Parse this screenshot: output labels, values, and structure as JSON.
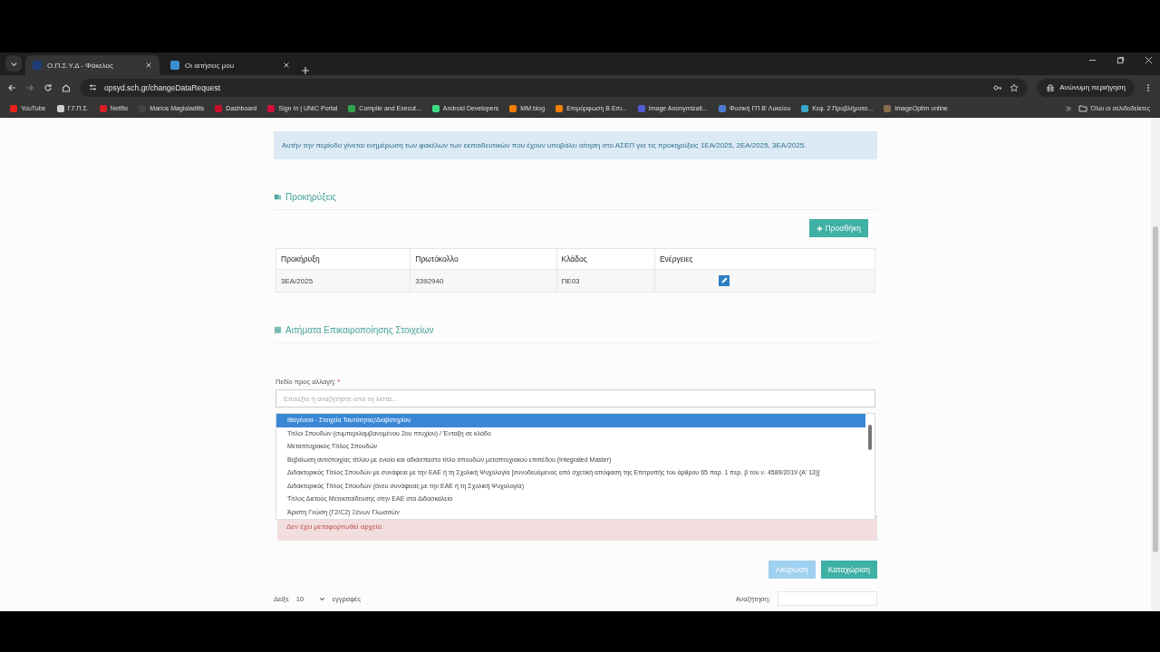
{
  "browser": {
    "tabs": [
      {
        "title": "Ο.Π.Σ.Υ.Δ - Φάκελος",
        "selected": true
      },
      {
        "title": "Οι αιτήσεις μου",
        "selected": false
      }
    ],
    "url": "opsyd.sch.gr/changeDataRequest",
    "profile_label": "Ανώνυμη περιήγηση",
    "bookmarks": [
      {
        "label": "YouTube",
        "color": "#e62117"
      },
      {
        "label": "Γ.Γ.Π.Σ.",
        "color": "#cfcfcf"
      },
      {
        "label": "Netflix",
        "color": "#d81f26"
      },
      {
        "label": "Marios Magioladitis",
        "color": "#444444"
      },
      {
        "label": "Dashboard",
        "color": "#c8102e"
      },
      {
        "label": "Sign In | UNIC Portal",
        "color": "#d0103a"
      },
      {
        "label": "Compile and Execut...",
        "color": "#2ea44f"
      },
      {
        "label": "Android Developers",
        "color": "#3ddc84"
      },
      {
        "label": "MM blog",
        "color": "#f57d00"
      },
      {
        "label": "Επιμόρφωση Β Επι...",
        "color": "#f57d00"
      },
      {
        "label": "Image Anonymizati...",
        "color": "#4f5bd5"
      },
      {
        "label": "Φυσική ΓΠ Β' Λυκείου",
        "color": "#4a7bd0"
      },
      {
        "label": "Κεφ. 2 Προβλήματα...",
        "color": "#3aa6c9"
      },
      {
        "label": "ImageOptim online",
        "color": "#8a6d4f"
      }
    ],
    "all_bookmarks": "Όλοι οι σελιδοδείκτες"
  },
  "page": {
    "notice": "Αυτήν την περίοδο γίνεται ενημέρωση των φακέλων των εκπαιδευτικών που έχουν υποβάλει αίτηση στο ΑΣΕΠ για τις προκηρύξεις 1ΕΑ/2025, 2ΕΑ/2025, 3ΕΑ/2025.",
    "announcements": {
      "title": "Προκηρύξεις",
      "add_button": "Προσθήκη",
      "columns": [
        "Προκήρυξη",
        "Πρωτόκολλο",
        "Κλάδος",
        "Ενέργειες"
      ],
      "rows": [
        [
          "3ΕΑ/2025",
          "3392940",
          "ΠΕ03"
        ]
      ]
    },
    "requests": {
      "title": "Αιτήματα Επικαιροποίησης Στοιχείων",
      "field_label": "Πεδίο προς αλλαγή:",
      "required_mark": "*",
      "placeholder": "Επιλέξτε ή αναζητήστε από τη λίστα...",
      "options": [
        {
          "label": "Ιθαγένεια - Στοιχεία Ταυτότητας/Διαβατηρίου",
          "selected": true
        },
        {
          "label": "Τίτλοι Σπουδών (συμπεριλαμβανομένου 2ου πτυχίου) / Ένταξη σε κλάδο",
          "selected": false
        },
        {
          "label": "Μεταπτυχιακός Τίτλος Σπουδών",
          "selected": false
        },
        {
          "label": "Βεβαίωση αντιστοιχίας τίτλου με ενιαίο και αδιάσπαστο τίτλο σπουδών μεταπτυχιακού επιπέδου (Integrated Master)",
          "selected": false
        },
        {
          "label": "Διδακτορικός Τίτλος Σπουδών με συνάφεια με την ΕΑΕ ή τη Σχολική Ψυχολογία [συνοδευόμενος από σχετική απόφαση της Επιτροπής του άρθρου 65 παρ. 1 περ. β του ν. 4589/2019 (Α' 13)]",
          "selected": false
        },
        {
          "label": "Διδακτορικός Τίτλος Σπουδών (άνευ συνάφειας με την ΕΑΕ ή τη Σχολική Ψυχολογία)",
          "selected": false
        },
        {
          "label": "Τίτλος Διετούς Μετεκπαίδευσης στην ΕΑΕ στα Διδασκαλεία",
          "selected": false
        },
        {
          "label": "Άριστη Γνώση (Γ2/C2) Ξένων Γλωσσών",
          "selected": false
        }
      ],
      "error": "Δεν έχει μεταφορτωθεί αρχείο.",
      "cancel_button": {
        "label": "Ακύρωση",
        "disabled": true
      },
      "submit_button": "Καταχώριση",
      "length": {
        "prefix": "Δείξε",
        "value": "10",
        "suffix": "εγγραφές"
      },
      "search_label": "Αναζήτηση:"
    }
  }
}
